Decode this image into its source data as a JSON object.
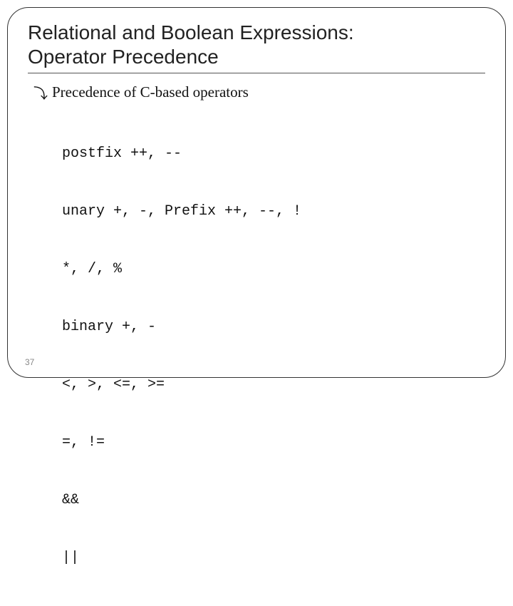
{
  "title_line1": "Relational and Boolean Expressions:",
  "title_line2": "Operator Precedence",
  "bullet": {
    "icon": "⤵",
    "text": "Precedence of C-based operators"
  },
  "code_lines": [
    "postfix ++, --",
    "unary +, -, Prefix ++, --, !",
    "*, /, %",
    "binary +, -",
    "<, >, <=, >=",
    "=, !=",
    "&&",
    "||"
  ],
  "page_number": "37"
}
